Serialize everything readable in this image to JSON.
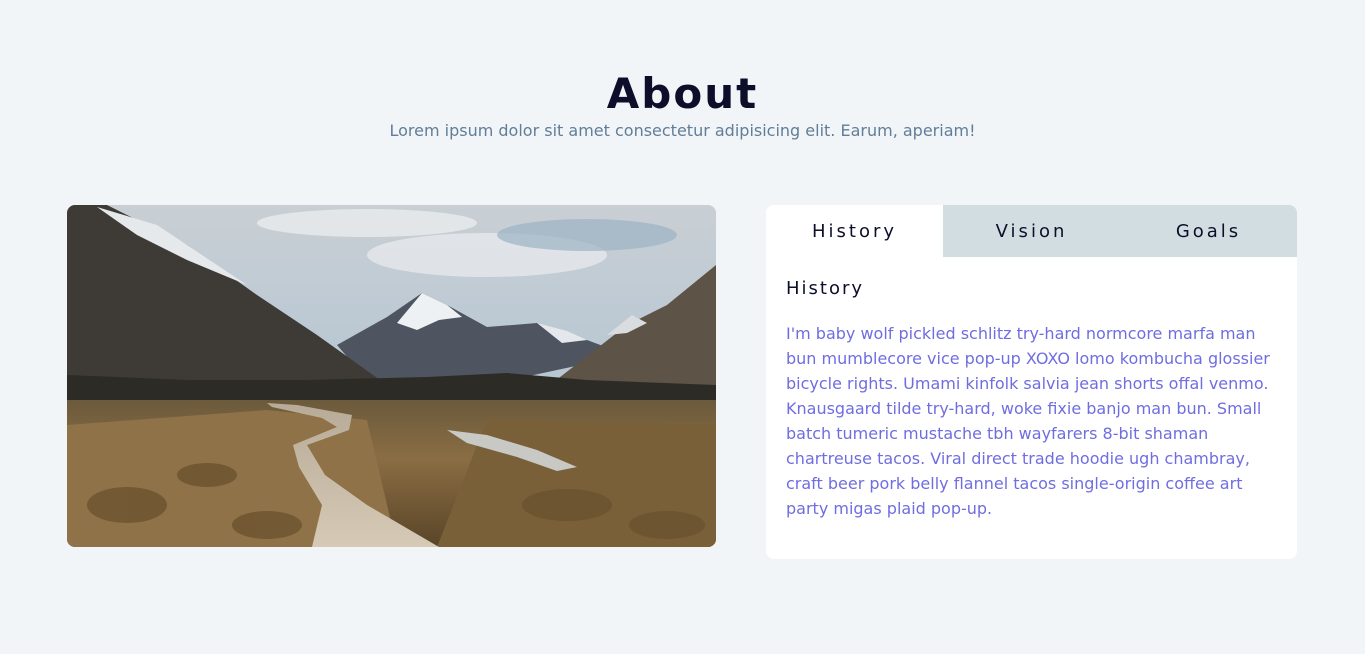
{
  "header": {
    "title": "About",
    "subtitle": "Lorem ipsum dolor sit amet consectetur adipisicing elit. Earum, aperiam!"
  },
  "tabs": [
    {
      "label": "History",
      "active": true
    },
    {
      "label": "Vision",
      "active": false
    },
    {
      "label": "Goals",
      "active": false
    }
  ],
  "content": {
    "title": "History",
    "text": "I'm baby wolf pickled schlitz try-hard normcore marfa man bun mumblecore vice pop-up XOXO lomo kombucha glossier bicycle rights. Umami kinfolk salvia jean shorts offal venmo. Knausgaard tilde try-hard, woke fixie banjo man bun. Small batch tumeric mustache tbh wayfarers 8-bit shaman chartreuse tacos. Viral direct trade hoodie ugh chambray, craft beer pork belly flannel tacos single-origin coffee art party migas plaid pop-up."
  },
  "image": {
    "subject": "mountain-valley-boardwalk-photo"
  },
  "colors": {
    "background": "#f1f5f8",
    "title": "#0d0f2a",
    "subtitle": "#617d98",
    "tab_inactive": "#d2dde2",
    "body_text": "#6f6de0"
  }
}
